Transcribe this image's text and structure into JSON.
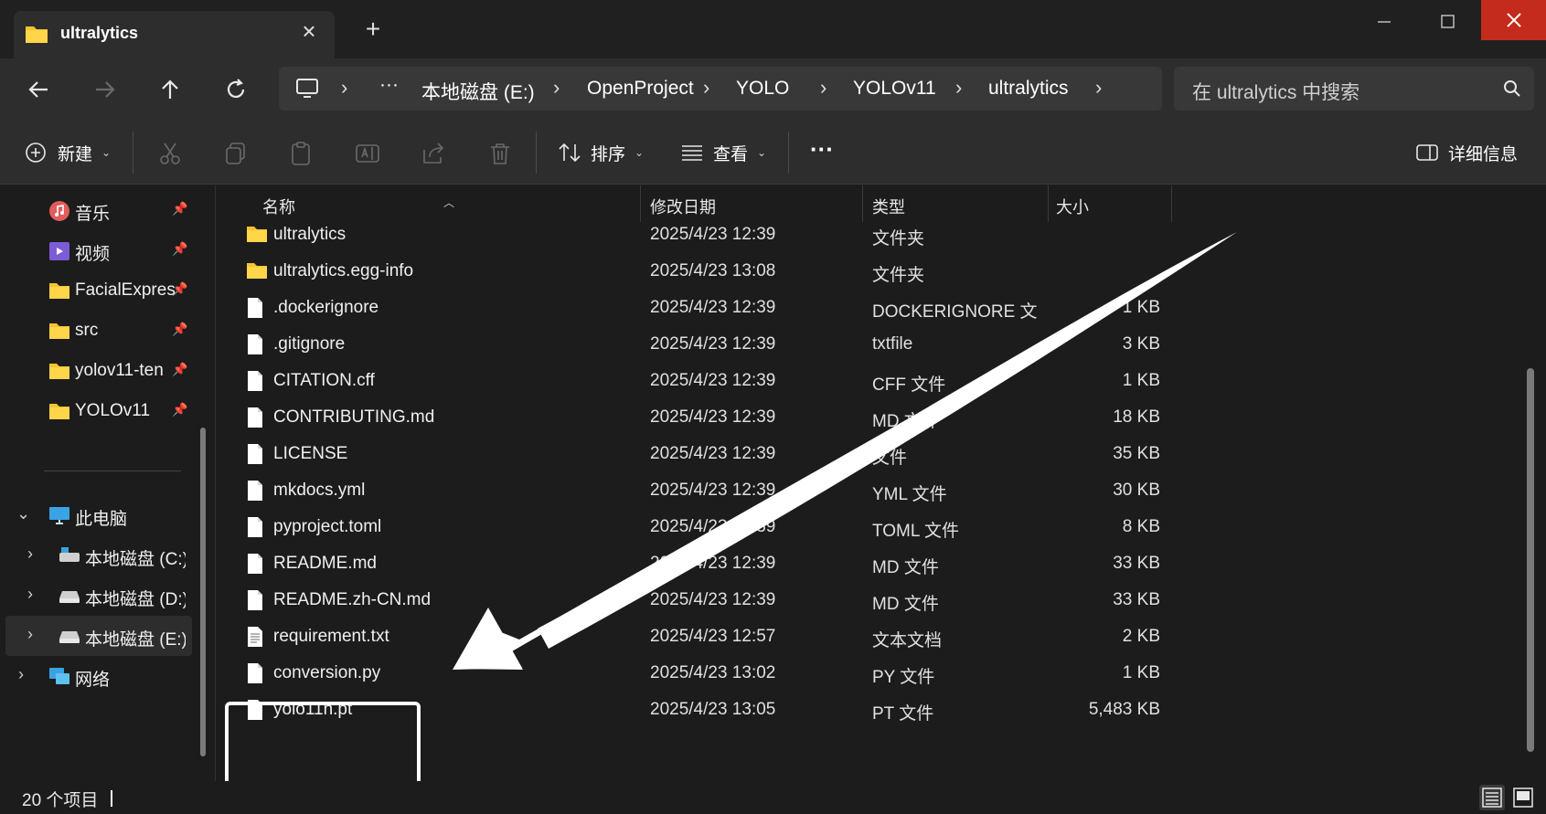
{
  "window": {
    "tab_title": "ultralytics",
    "new_tab_label": "+",
    "close_tab_label": "×"
  },
  "address": {
    "crumbs": [
      "本地磁盘 (E:)",
      "OpenProject",
      "YOLO",
      "YOLOv11",
      "ultralytics"
    ],
    "ellipsis": "···",
    "search_placeholder": "在 ultralytics 中搜索"
  },
  "toolbar": {
    "new_label": "新建",
    "sort_label": "排序",
    "view_label": "查看",
    "more_label": "···",
    "details_label": "详细信息"
  },
  "sidebar": {
    "quick": [
      {
        "label": "音乐",
        "icon": "music-icon"
      },
      {
        "label": "视频",
        "icon": "video-icon"
      },
      {
        "label": "FacialExpres",
        "icon": "folder-icon"
      },
      {
        "label": "src",
        "icon": "folder-icon"
      },
      {
        "label": "yolov11-ten",
        "icon": "folder-icon"
      },
      {
        "label": "YOLOv11",
        "icon": "folder-icon"
      }
    ],
    "this_pc": "此电脑",
    "drives": [
      "本地磁盘 (C:)",
      "本地磁盘 (D:)",
      "本地磁盘 (E:)"
    ],
    "network": "网络"
  },
  "columns": {
    "name": "名称",
    "date": "修改日期",
    "type": "类型",
    "size": "大小"
  },
  "files": [
    {
      "name": "ultralytics",
      "date": "2025/4/23 12:39",
      "type": "文件夹",
      "size": "",
      "kind": "folder"
    },
    {
      "name": "ultralytics.egg-info",
      "date": "2025/4/23 13:08",
      "type": "文件夹",
      "size": "",
      "kind": "folder"
    },
    {
      "name": ".dockerignore",
      "date": "2025/4/23 12:39",
      "type": "DOCKERIGNORE 文...",
      "size": "1 KB",
      "kind": "file"
    },
    {
      "name": ".gitignore",
      "date": "2025/4/23 12:39",
      "type": "txtfile",
      "size": "3 KB",
      "kind": "file"
    },
    {
      "name": "CITATION.cff",
      "date": "2025/4/23 12:39",
      "type": "CFF 文件",
      "size": "1 KB",
      "kind": "file"
    },
    {
      "name": "CONTRIBUTING.md",
      "date": "2025/4/23 12:39",
      "type": "MD 文件",
      "size": "18 KB",
      "kind": "file"
    },
    {
      "name": "LICENSE",
      "date": "2025/4/23 12:39",
      "type": "文件",
      "size": "35 KB",
      "kind": "file"
    },
    {
      "name": "mkdocs.yml",
      "date": "2025/4/23 12:39",
      "type": "YML 文件",
      "size": "30 KB",
      "kind": "file"
    },
    {
      "name": "pyproject.toml",
      "date": "2025/4/23 12:39",
      "type": "TOML 文件",
      "size": "8 KB",
      "kind": "file"
    },
    {
      "name": "README.md",
      "date": "2025/4/23 12:39",
      "type": "MD 文件",
      "size": "33 KB",
      "kind": "file"
    },
    {
      "name": "README.zh-CN.md",
      "date": "2025/4/23 12:39",
      "type": "MD 文件",
      "size": "33 KB",
      "kind": "file"
    },
    {
      "name": "requirement.txt",
      "date": "2025/4/23 12:57",
      "type": "文本文档",
      "size": "2 KB",
      "kind": "text"
    },
    {
      "name": "conversion.py",
      "date": "2025/4/23 13:02",
      "type": "PY 文件",
      "size": "1 KB",
      "kind": "file"
    },
    {
      "name": "yolo11n.pt",
      "date": "2025/4/23 13:05",
      "type": "PT 文件",
      "size": "5,483 KB",
      "kind": "file"
    }
  ],
  "status": {
    "count": "20 个项目"
  },
  "colors": {
    "accent_close": "#c42b1c",
    "folder": "#f4c430",
    "bg": "#1c1c1c"
  }
}
